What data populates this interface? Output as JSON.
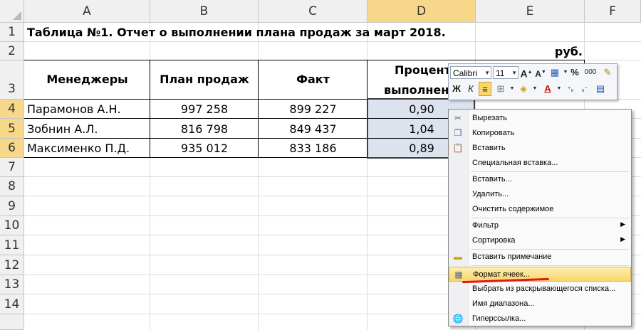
{
  "columns": [
    "A",
    "B",
    "C",
    "D",
    "E",
    "F"
  ],
  "rows": [
    "1",
    "2",
    "3",
    "4",
    "5",
    "6",
    "7",
    "8",
    "9",
    "10",
    "11",
    "12",
    "13",
    "14"
  ],
  "sheet": {
    "title": "Таблица №1. Отчет о выполнении плана продаж за март 2018.",
    "unit": "руб.",
    "headers": [
      "Менеджеры",
      "План продаж",
      "Факт",
      "Процент",
      "выполнени"
    ],
    "data": [
      {
        "name": "Парамонов А.Н.",
        "plan": "997 258",
        "fact": "899 227",
        "pct": "0,90"
      },
      {
        "name": "Зобнин А.Л.",
        "plan": "816 798",
        "fact": "849 437",
        "pct": "1,04"
      },
      {
        "name": "Максименко П.Д.",
        "plan": "935 012",
        "fact": "833 186",
        "pct": "0,89"
      }
    ]
  },
  "mini_toolbar": {
    "font": "Calibri",
    "size": "11",
    "buttons": [
      "A",
      "A",
      "%",
      "000",
      "Ж",
      "К"
    ]
  },
  "context_menu": {
    "items": [
      "Вырезать",
      "Копировать",
      "Вставить",
      "Специальная вставка...",
      "Вставить...",
      "Удалить...",
      "Очистить содержимое",
      "Фильтр",
      "Сортировка",
      "Вставить примечание",
      "Формат ячеек...",
      "Выбрать из раскрывающегося списка...",
      "Имя диапазона...",
      "Гиперссылка..."
    ]
  }
}
